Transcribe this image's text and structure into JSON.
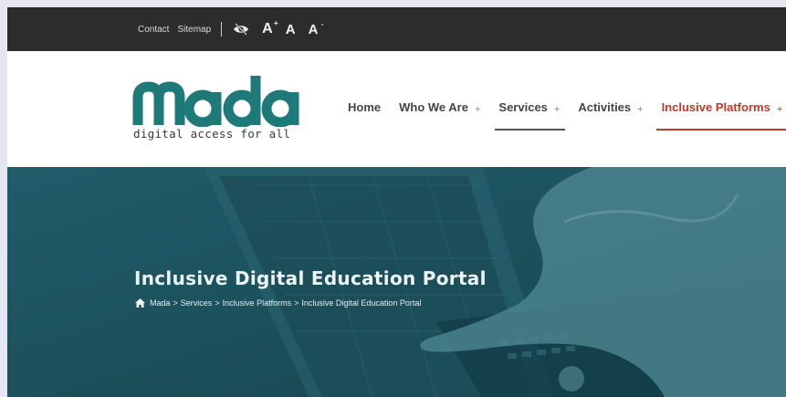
{
  "topbar": {
    "contact": "Contact",
    "sitemap": "Sitemap",
    "font_increase": "A",
    "font_increase_sup": "+",
    "font_normal": "A",
    "font_decrease": "A",
    "font_decrease_sup": "-"
  },
  "logo": {
    "name": "mada",
    "tagline": "digital access for all",
    "color": "#1e7a78"
  },
  "nav": {
    "items": [
      {
        "label": "Home",
        "plus": ""
      },
      {
        "label": "Who We Are",
        "plus": "+"
      },
      {
        "label": "Services",
        "plus": "+"
      },
      {
        "label": "Activities",
        "plus": "+"
      },
      {
        "label": "Inclusive Platforms",
        "plus": "+"
      }
    ],
    "active_color": "#c0392b"
  },
  "hero": {
    "title": "Inclusive Digital Education Portal",
    "breadcrumb": {
      "items": [
        "Mada",
        "Services",
        "Inclusive Platforms",
        "Inclusive Digital Education Portal"
      ],
      "separator": ">"
    },
    "overlay_color": "#1d5360"
  }
}
